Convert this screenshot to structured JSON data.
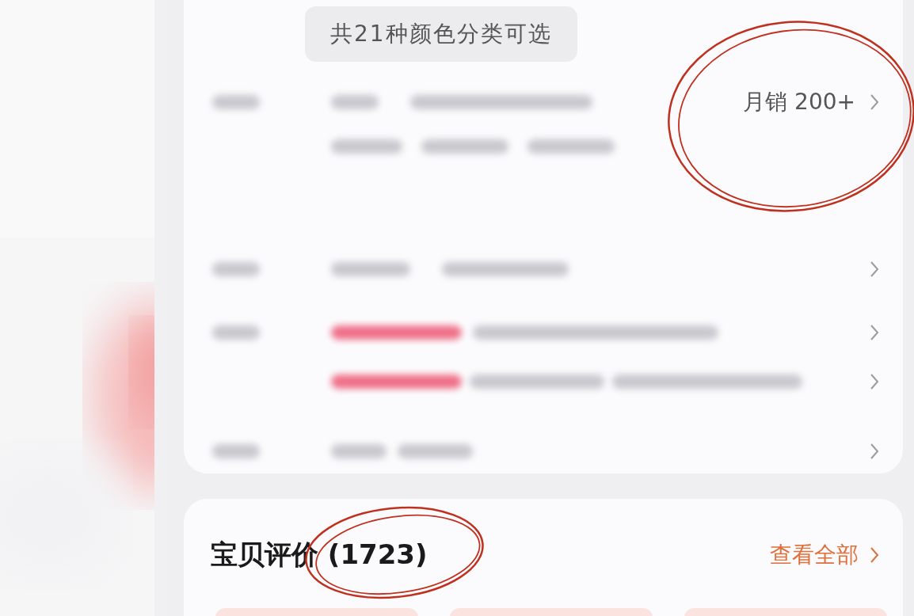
{
  "spec_card": {
    "color_note": "共21种颜色分类可选",
    "rows": [
      {
        "kind": "detail",
        "trailing": "月销 200+",
        "circled": true
      },
      {
        "kind": "single"
      },
      {
        "kind": "promo"
      },
      {
        "kind": "promo_more"
      },
      {
        "kind": "single_short"
      }
    ]
  },
  "reviews": {
    "title": "宝贝评价 (1723)",
    "circled": true,
    "link": "查看全部"
  }
}
